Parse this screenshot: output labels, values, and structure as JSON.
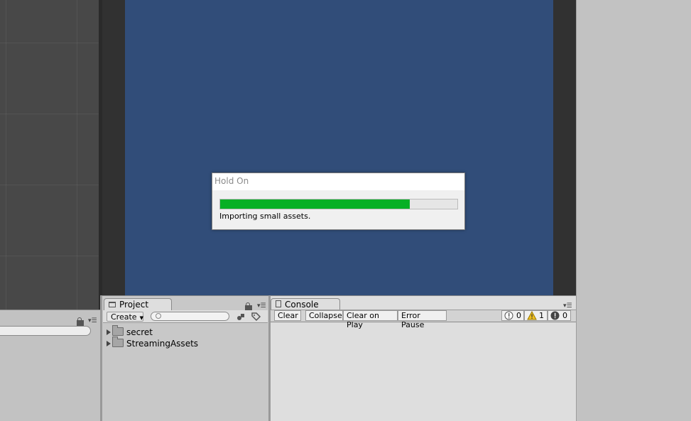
{
  "dialog": {
    "title": "Hold On",
    "progress_text": "Importing small assets.",
    "progress": 0.8,
    "progress_color": "#06b025"
  },
  "game_view": {
    "background_color": "#314d79"
  },
  "project": {
    "tab_label": "Project",
    "tab_icon": "folder-icon",
    "create_label": "Create",
    "search_placeholder": "",
    "tree": [
      {
        "label": "secret",
        "icon": "folder-icon"
      },
      {
        "label": "StreamingAssets",
        "icon": "folder-icon"
      }
    ]
  },
  "console": {
    "tab_label": "Console",
    "tab_icon": "console-icon",
    "buttons": {
      "clear": "Clear",
      "collapse": "Collapse",
      "clear_on_play": "Clear on Play",
      "error_pause": "Error Pause"
    },
    "counts": {
      "info": "0",
      "warning": "1",
      "error": "0"
    }
  }
}
